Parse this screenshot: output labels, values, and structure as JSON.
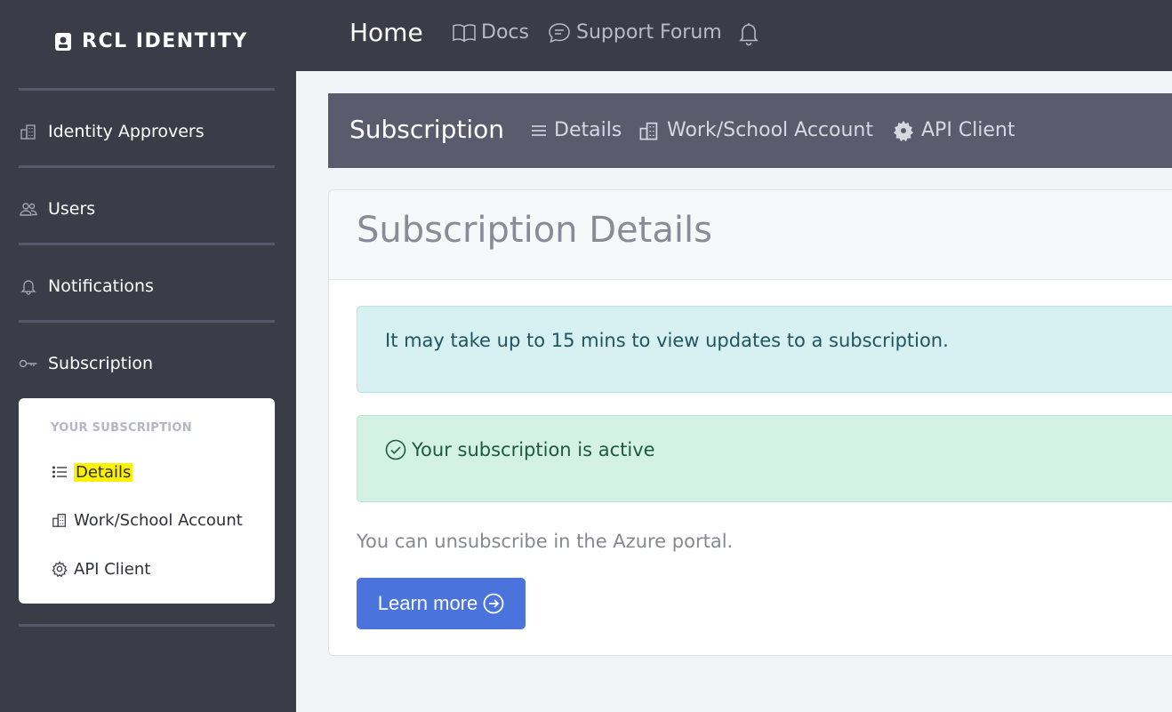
{
  "brand": {
    "name": "RCL IDENTITY"
  },
  "sidebar": {
    "items": [
      {
        "label": "Identity Approvers",
        "icon": "building-icon"
      },
      {
        "label": "Users",
        "icon": "users-icon"
      },
      {
        "label": "Notifications",
        "icon": "bell-icon"
      },
      {
        "label": "Subscription",
        "icon": "key-icon"
      }
    ],
    "subscription_panel": {
      "heading": "YOUR SUBSCRIPTION",
      "items": [
        {
          "label": "Details",
          "icon": "list-icon",
          "highlighted": true
        },
        {
          "label": "Work/School Account",
          "icon": "building-icon"
        },
        {
          "label": "API Client",
          "icon": "gear-icon"
        }
      ]
    }
  },
  "topbar": {
    "home": "Home",
    "docs": "Docs",
    "forum": "Support Forum"
  },
  "subnav": {
    "title": "Subscription",
    "links": [
      {
        "label": "Details",
        "icon": "list-icon"
      },
      {
        "label": "Work/School Account",
        "icon": "building-icon"
      },
      {
        "label": "API Client",
        "icon": "gear-icon"
      }
    ]
  },
  "main": {
    "title": "Subscription Details",
    "info_alert": "It may take up to 15 mins to view updates to a subscription.",
    "success_alert": "Your subscription is active",
    "unsubscribe_text": "You can unsubscribe in the Azure portal.",
    "learn_more": "Learn more"
  },
  "colors": {
    "sidebar_bg": "#3b3c48",
    "subnav_bg": "#5a5b6c",
    "accent": "#4a73dc",
    "info_bg": "#d7f0f2",
    "success_bg": "#d3f2e5",
    "highlight": "#fff200"
  }
}
